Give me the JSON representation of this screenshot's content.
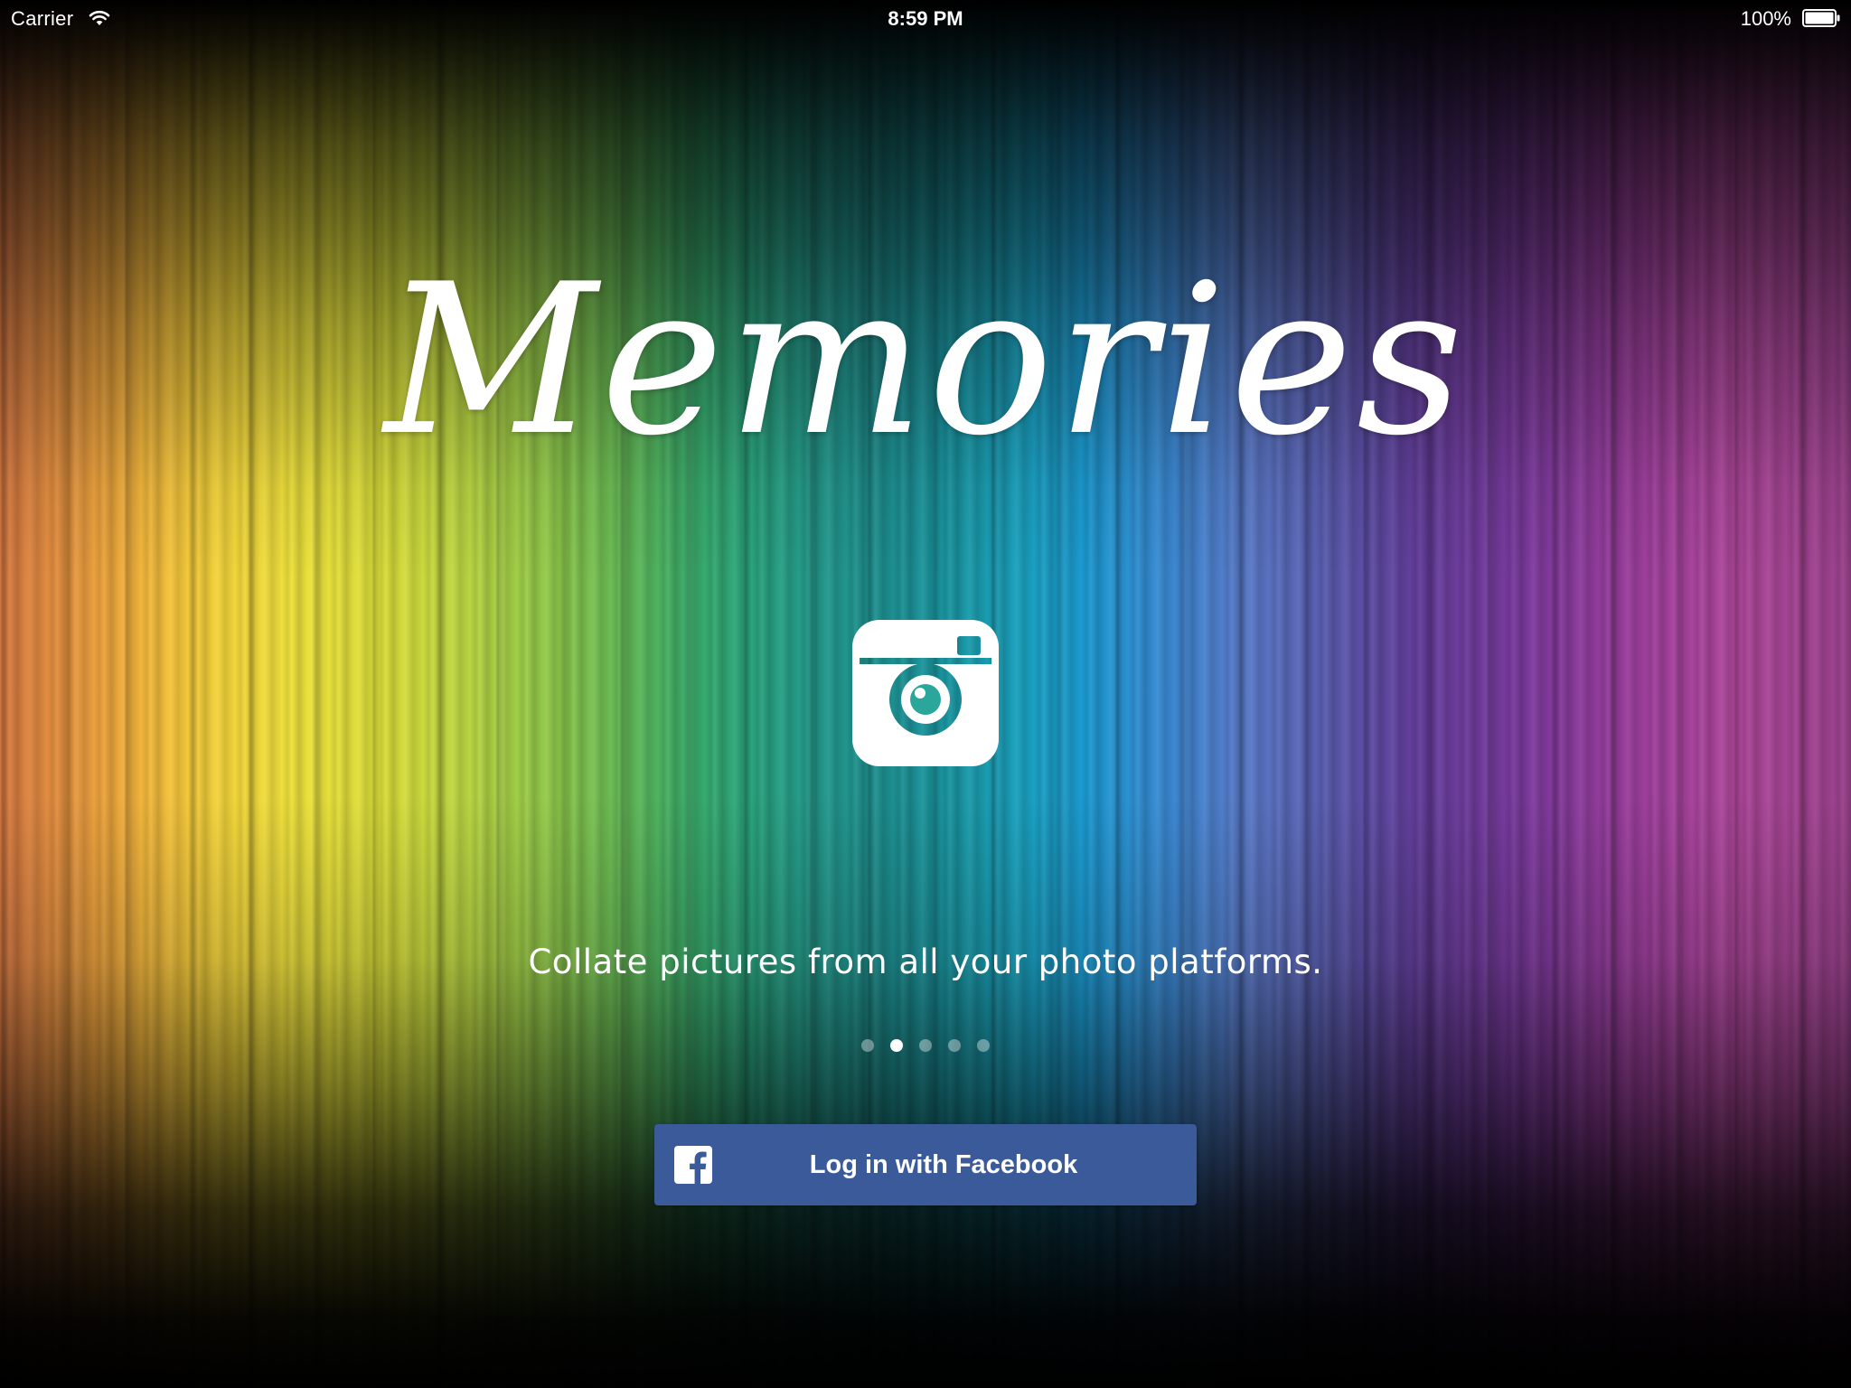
{
  "status_bar": {
    "carrier": "Carrier",
    "time": "8:59 PM",
    "battery": "100%",
    "wifi_icon": "wifi-icon",
    "battery_icon": "battery-icon"
  },
  "app": {
    "title": "Memories",
    "feature_icon": "camera-icon",
    "tagline": "Collate pictures from all your photo platforms."
  },
  "pager": {
    "total_pages": 5,
    "current_page": 2
  },
  "login": {
    "label": "Log in with Facebook",
    "icon": "facebook-icon",
    "color": "#3b5a9a"
  }
}
